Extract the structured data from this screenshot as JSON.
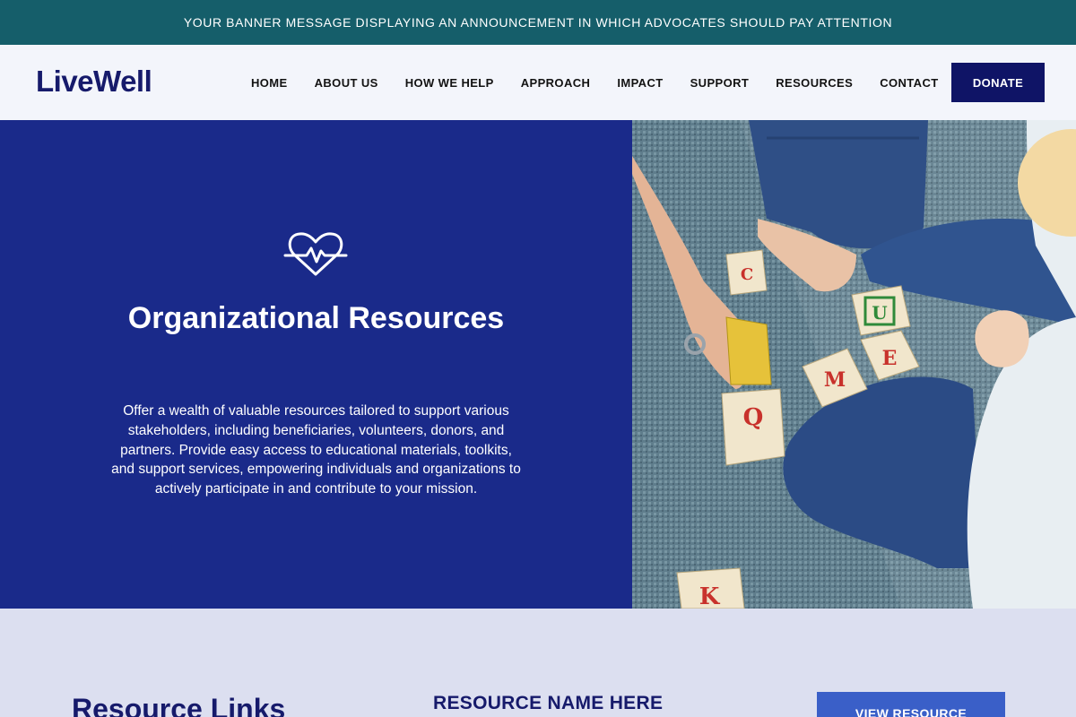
{
  "banner": {
    "message": "YOUR BANNER MESSAGE DISPLAYING AN ANNOUNCEMENT IN WHICH ADVOCATES SHOULD PAY ATTENTION"
  },
  "header": {
    "logo": "LiveWell",
    "nav": [
      "HOME",
      "ABOUT US",
      "HOW WE HELP",
      "APPROACH",
      "IMPACT",
      "SUPPORT",
      "RESOURCES",
      "CONTACT"
    ],
    "donate_label": "DONATE"
  },
  "hero": {
    "icon": "heart-pulse-icon",
    "title": "Organizational Resources",
    "text": "Offer a wealth of valuable resources tailored to support various stakeholders, including beneficiaries, volunteers, donors, and partners. Provide easy access to educational materials, toolkits, and support services, empowering individuals and organizations to actively participate in and contribute to your mission.",
    "photo_letters": [
      "E",
      "M",
      "Q",
      "U",
      "K",
      "C"
    ]
  },
  "resources": {
    "heading": "Resource Links",
    "item_name": "RESOURCE NAME HERE",
    "view_label": "VIEW RESOURCE"
  },
  "colors": {
    "banner": "#155e6a",
    "header_bg": "#f3f5fb",
    "brand_navy": "#161a6b",
    "hero_blue": "#1a2a8a",
    "section_bg": "#dcdff0",
    "button_blue": "#3a5fc8"
  }
}
